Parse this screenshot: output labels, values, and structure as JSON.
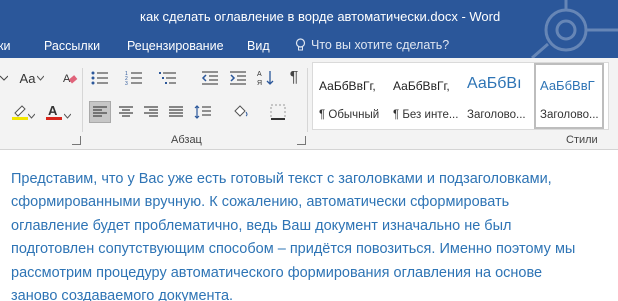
{
  "window": {
    "title": "как сделать оглавление в ворде автоматически.docx - Word"
  },
  "tabs": [
    {
      "label": "ки"
    },
    {
      "label": "Рассылки"
    },
    {
      "label": "Рецензирование"
    },
    {
      "label": "Вид"
    }
  ],
  "tell_me": {
    "placeholder": "Что вы хотите сделать?",
    "icon": "lightbulb-icon"
  },
  "ribbon": {
    "font_group": {
      "case_button": "Aa",
      "highlight_color": "#f2e600",
      "font_color": "#d9251c"
    },
    "paragraph_group": {
      "label": "Абзац",
      "pilcrow": "¶"
    },
    "styles_group": {
      "label": "Стили",
      "items": [
        {
          "preview": "АаБбВвГг,",
          "name": "¶ Обычный"
        },
        {
          "preview": "АаБбВвГг,",
          "name": "¶ Без инте..."
        },
        {
          "preview": "АаБбВı",
          "name": "Заголово..."
        },
        {
          "preview": "АаБбВвГ",
          "name": "Заголово..."
        }
      ]
    }
  },
  "document": {
    "lines": [
      "Представим, что у Вас уже есть готовый текст с заголовками и подзаголовками,",
      "сформированными вручную. К сожалению, автоматически сформировать",
      "оглавление будет проблематично, ведь Ваш документ изначально не был",
      "подготовлен сопутствующим способом – придётся повозиться. Именно поэтому мы",
      "рассмотрим процедуру автоматического формирования оглавления на основе",
      "заново создаваемого документа."
    ],
    "text_color": "#2e74b5"
  },
  "colors": {
    "title_bar": "#2b579a",
    "ribbon_bg": "#f3f3f3"
  }
}
